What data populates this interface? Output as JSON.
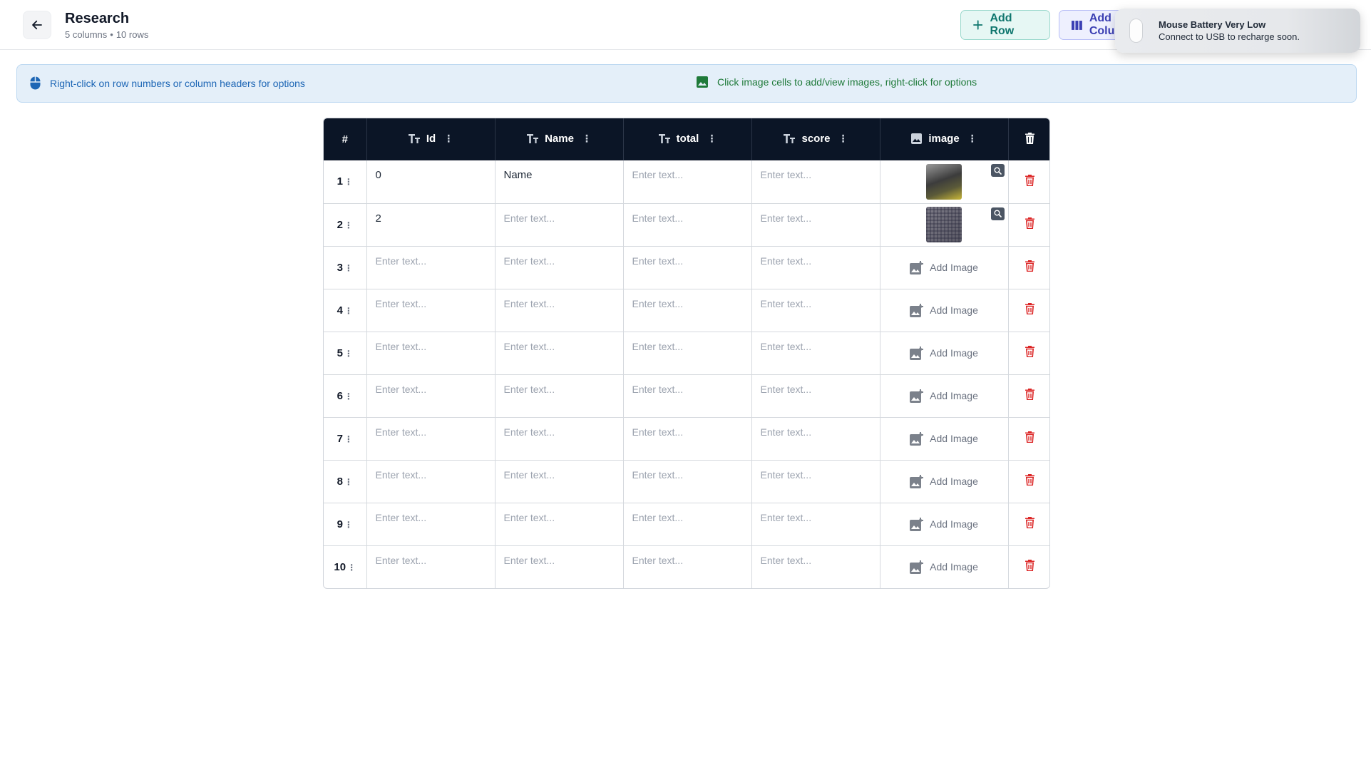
{
  "header": {
    "title": "Research",
    "column_count": "5 columns",
    "row_count": "10 rows",
    "separator": "•",
    "add_row_label": "Add Row",
    "add_column_label": "Add Column"
  },
  "notification": {
    "title": "Mouse Battery Very Low",
    "body": "Connect to USB to recharge soon."
  },
  "banner": {
    "left_text": "Right-click on row numbers or column headers for options",
    "right_text": "Click image cells to add/view images, right-click for options",
    "left_color": "#1d66b5",
    "right_color": "#1f7a3a"
  },
  "table": {
    "index_header": "#",
    "columns": [
      {
        "name": "Id",
        "type": "text",
        "icon": "text-type-icon"
      },
      {
        "name": "Name",
        "type": "text",
        "icon": "text-type-icon"
      },
      {
        "name": "total",
        "type": "text",
        "icon": "text-type-icon"
      },
      {
        "name": "score",
        "type": "text",
        "icon": "text-type-icon"
      },
      {
        "name": "image",
        "type": "image",
        "icon": "image-type-icon"
      }
    ],
    "placeholder": "Enter text...",
    "add_image_label": "Add Image",
    "rows": [
      {
        "num": "1",
        "id": "0",
        "name": "Name",
        "total": "",
        "score": "",
        "has_image": true
      },
      {
        "num": "2",
        "id": "2",
        "name": "",
        "total": "",
        "score": "",
        "has_image": true
      },
      {
        "num": "3",
        "id": "",
        "name": "",
        "total": "",
        "score": "",
        "has_image": false
      },
      {
        "num": "4",
        "id": "",
        "name": "",
        "total": "",
        "score": "",
        "has_image": false
      },
      {
        "num": "5",
        "id": "",
        "name": "",
        "total": "",
        "score": "",
        "has_image": false
      },
      {
        "num": "6",
        "id": "",
        "name": "",
        "total": "",
        "score": "",
        "has_image": false
      },
      {
        "num": "7",
        "id": "",
        "name": "",
        "total": "",
        "score": "",
        "has_image": false
      },
      {
        "num": "8",
        "id": "",
        "name": "",
        "total": "",
        "score": "",
        "has_image": false
      },
      {
        "num": "9",
        "id": "",
        "name": "",
        "total": "",
        "score": "",
        "has_image": false
      },
      {
        "num": "10",
        "id": "",
        "name": "",
        "total": "",
        "score": "",
        "has_image": false
      }
    ]
  },
  "colors": {
    "header_bg": "#0b1526",
    "delete_red": "#dc2626",
    "add_row_teal": "#0f766e",
    "add_column_indigo": "#3b3fb3"
  }
}
